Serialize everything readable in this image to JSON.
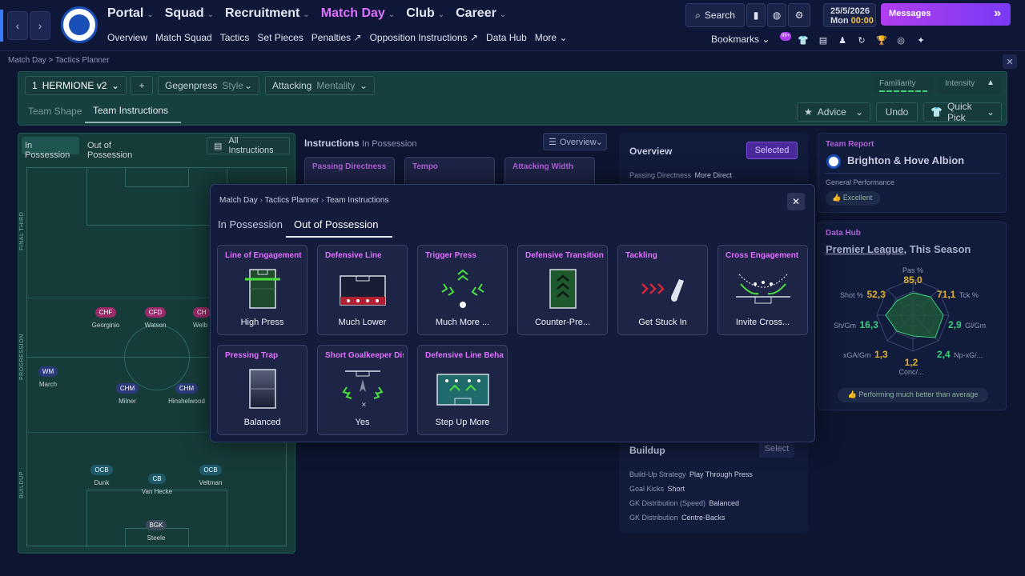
{
  "nav": {
    "main": [
      {
        "label": "Portal",
        "active": false
      },
      {
        "label": "Squad",
        "active": false
      },
      {
        "label": "Recruitment",
        "active": false
      },
      {
        "label": "Match Day",
        "active": true
      },
      {
        "label": "Club",
        "active": false
      },
      {
        "label": "Career",
        "active": false
      }
    ],
    "sub": [
      "Overview",
      "Match Squad",
      "Tactics",
      "Set Pieces",
      "Penalties",
      "Opposition Instructions",
      "Data Hub",
      "More"
    ],
    "search_label": "Search",
    "date": "25/5/2026",
    "day": "Mon",
    "time": "00:00",
    "messages_label": "Messages",
    "bookmarks_label": "Bookmarks",
    "notif_badge": "99+"
  },
  "breadcrumb": "Match Day > Tactics Planner",
  "tactics": {
    "formation_num": "1",
    "formation_name": "HERMIONE v2",
    "style_value": "Gegenpress",
    "style_label": "Style",
    "mentality_value": "Attacking",
    "mentality_label": "Mentality",
    "familiarity_label": "Familiarity",
    "intensity_label": "Intensity",
    "tabs": [
      "Team Shape",
      "Team Instructions"
    ],
    "advice_label": "Advice",
    "undo_label": "Undo",
    "quickpick_label": "Quick Pick"
  },
  "pitch": {
    "tabs": [
      "In Possession",
      "Out of Possession"
    ],
    "all_instructions": "All Instructions",
    "zones": [
      "FINAL THIRD",
      "PROGRESSION",
      "BUILDUP"
    ],
    "players": [
      {
        "pos": "CHF",
        "name": "Georginio",
        "color": "#9a2a6a"
      },
      {
        "pos": "CFD",
        "name": "Watson",
        "color": "#9a2a6a"
      },
      {
        "pos": "CH",
        "name": "Welb",
        "color": "#9a2a6a"
      },
      {
        "pos": "WM",
        "name": "March",
        "color": "#2a3a7a"
      },
      {
        "pos": "CHM",
        "name": "Milner",
        "color": "#2a3a7a"
      },
      {
        "pos": "CHM",
        "name": "Hinshelwood",
        "color": "#2a3a7a"
      },
      {
        "pos": "OCB",
        "name": "Dunk",
        "color": "#1f5a6a"
      },
      {
        "pos": "CB",
        "name": "Van Hecke",
        "color": "#1f5a6a"
      },
      {
        "pos": "OCB",
        "name": "Veltman",
        "color": "#1f5a6a"
      },
      {
        "pos": "BGK",
        "name": "Steele",
        "color": "#3a4a5a"
      }
    ]
  },
  "instructions": {
    "title": "Instructions",
    "subtitle": "In Possession",
    "view": "Overview",
    "cards": [
      "Passing Directness",
      "Tempo",
      "Attacking Width"
    ]
  },
  "overview": {
    "title": "Overview",
    "selected_label": "Selected",
    "row1_label": "Passing Directness",
    "row1_value": "More Direct",
    "buildup_title": "Buildup",
    "select_label": "Select",
    "buildup": [
      {
        "label": "Build-Up Strategy",
        "value": "Play Through Press"
      },
      {
        "label": "Goal Kicks",
        "value": "Short"
      },
      {
        "label": "GK Distribution (Speed)",
        "value": "Balanced"
      },
      {
        "label": "GK Distribution",
        "value": "Centre-Backs"
      }
    ]
  },
  "team_report": {
    "title": "Team Report",
    "team": "Brighton & Hove Albion",
    "perf_label": "General Performance",
    "perf_value": "Excellent"
  },
  "data_hub": {
    "title": "Data Hub",
    "league": "Premier League",
    "period": ", This Season",
    "stats": [
      {
        "label": "Pas %",
        "value": "85,0",
        "color": "#e0b030"
      },
      {
        "label": "Tck %",
        "value": "71,1",
        "color": "#e0b030"
      },
      {
        "label": "Gl/Gm",
        "value": "2,9",
        "color": "#3ad07a"
      },
      {
        "label": "Np-xG/...",
        "value": "2,4",
        "color": "#3ad07a"
      },
      {
        "label": "Conc/...",
        "value": "1,2",
        "color": "#e0b030"
      },
      {
        "label": "xGA/Gm",
        "value": "1,3",
        "color": "#e0b030"
      },
      {
        "label": "Sh/Gm",
        "value": "16,3",
        "color": "#3ad07a"
      },
      {
        "label": "Shot %",
        "value": "52,3",
        "color": "#e0b030"
      }
    ],
    "footer": "Performing much better than average"
  },
  "modal": {
    "breadcrumb": [
      "Match Day",
      "Tactics Planner",
      "Team Instructions"
    ],
    "tabs": [
      "In Possession",
      "Out of Possession"
    ],
    "cards": [
      {
        "title": "Line of Engagement",
        "value": "High Press",
        "icon": "line-of-engagement-icon"
      },
      {
        "title": "Defensive Line",
        "value": "Much Lower",
        "icon": "defensive-line-icon"
      },
      {
        "title": "Trigger Press",
        "value": "Much More ...",
        "icon": "trigger-press-icon"
      },
      {
        "title": "Defensive Transition",
        "value": "Counter-Pre...",
        "icon": "defensive-transition-icon"
      },
      {
        "title": "Tackling",
        "value": "Get Stuck In",
        "icon": "tackling-icon"
      },
      {
        "title": "Cross Engagement",
        "value": "Invite Cross...",
        "icon": "cross-engagement-icon"
      },
      {
        "title": "Pressing Trap",
        "value": "Balanced",
        "icon": "pressing-trap-icon"
      },
      {
        "title": "Short Goalkeeper Distr",
        "value": "Yes",
        "icon": "short-goalkeeper-icon"
      },
      {
        "title": "Defensive Line Behavic",
        "value": "Step Up More",
        "icon": "defensive-line-behaviour-icon"
      }
    ]
  }
}
